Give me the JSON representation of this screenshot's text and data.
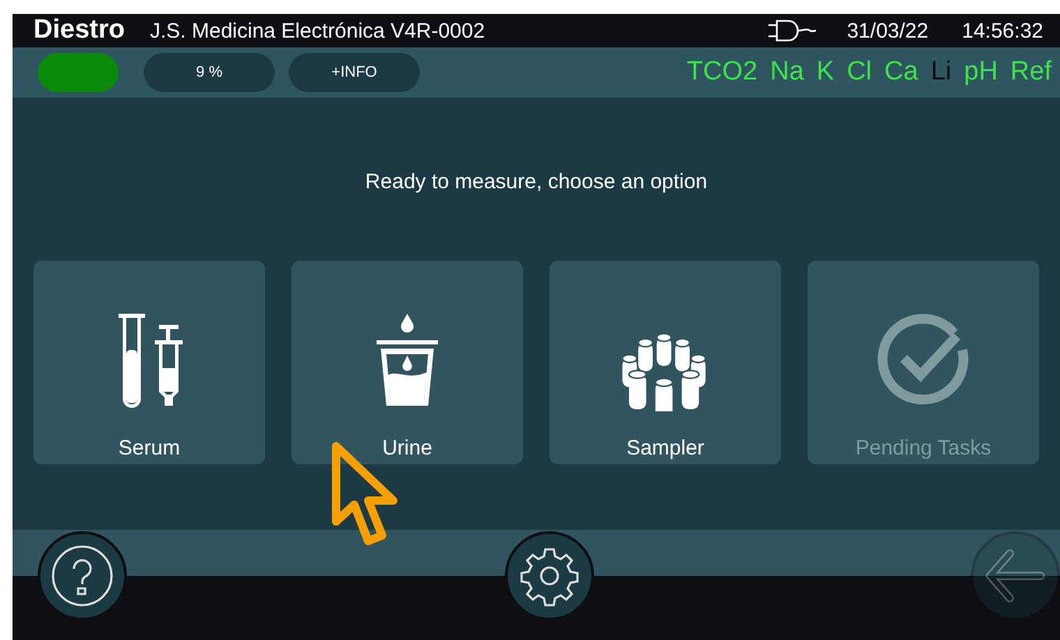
{
  "header": {
    "brand": "Diestro",
    "title": "J.S. Medicina Electrónica V4R-0002",
    "date": "31/03/22",
    "time": "14:56:32"
  },
  "status_bar": {
    "progress": "9 %",
    "info_button": "+INFO",
    "analytes": [
      {
        "label": "TCO2",
        "active": true
      },
      {
        "label": "Na",
        "active": true
      },
      {
        "label": "K",
        "active": true
      },
      {
        "label": "Cl",
        "active": true
      },
      {
        "label": "Ca",
        "active": true
      },
      {
        "label": "Li",
        "active": false
      },
      {
        "label": "pH",
        "active": true
      },
      {
        "label": "Ref",
        "active": true
      }
    ]
  },
  "message": "Ready to measure, choose an option",
  "options": [
    {
      "kind": "serum",
      "label": "Serum",
      "disabled": false
    },
    {
      "kind": "urine",
      "label": "Urine",
      "disabled": false
    },
    {
      "kind": "sampler",
      "label": "Sampler",
      "disabled": false
    },
    {
      "kind": "pending",
      "label": "Pending Tasks",
      "disabled": true
    }
  ],
  "footer": {
    "back_disabled": true
  }
}
